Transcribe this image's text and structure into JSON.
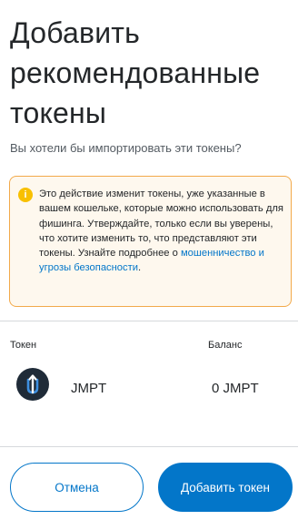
{
  "page": {
    "title": "Добавить рекомендованные токены",
    "subtitle": "Вы хотели бы импортировать эти токены?"
  },
  "warning": {
    "icon": "info-icon",
    "text": "Это действие изменит токены, уже указанные в вашем кошельке, которые можно использовать для фишинга. Утверждайте, только если вы уверены, что хотите изменить то, что представляют эти токены. Узнайте подробнее о ",
    "link_text": "мошенничество и угрозы безопасности",
    "after_link": ".",
    "colors": {
      "background": "#fef8ee",
      "border": "#f2a94a",
      "icon": "#f8c000",
      "link": "#0376c9"
    }
  },
  "table": {
    "token_header": "Токен",
    "balance_header": "Баланс",
    "rows": [
      {
        "icon": "jmpt-token-icon",
        "symbol": "JMPT",
        "balance": "0 JMPT"
      }
    ]
  },
  "footer": {
    "cancel_label": "Отмена",
    "add_label": "Добавить токен",
    "accent_color": "#0376c9"
  }
}
